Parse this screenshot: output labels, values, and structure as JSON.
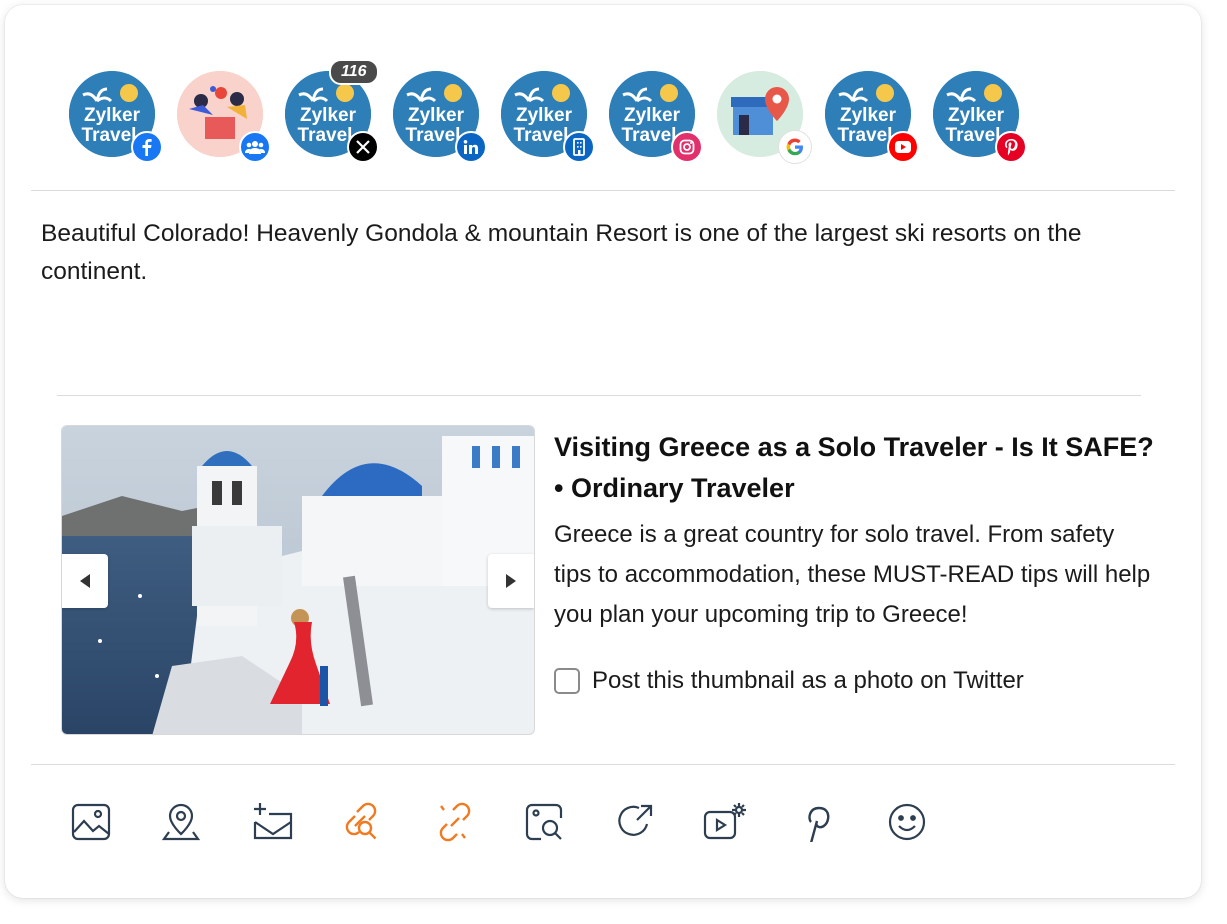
{
  "accounts": [
    {
      "name": "Zylker Travel",
      "network": "facebook",
      "icon": "facebook-icon",
      "badge_color": "#1877f2"
    },
    {
      "name": "Group",
      "network": "facebook-group",
      "icon": "group-icon",
      "badge_color": "#1877f2"
    },
    {
      "name": "Zylker Travel",
      "network": "x",
      "icon": "x-icon",
      "badge_color": "#000000",
      "count": "116"
    },
    {
      "name": "Zylker Travel",
      "network": "linkedin",
      "icon": "linkedin-icon",
      "badge_color": "#0a66c2"
    },
    {
      "name": "Zylker Travel",
      "network": "linkedin-page",
      "icon": "building-icon",
      "badge_color": "#0a66c2"
    },
    {
      "name": "Zylker Travel",
      "network": "instagram",
      "icon": "instagram-icon",
      "badge_color": "#e1306c"
    },
    {
      "name": "Google Business",
      "network": "google",
      "icon": "google-icon",
      "badge_color": "#4285f4"
    },
    {
      "name": "Zylker Travel",
      "network": "youtube",
      "icon": "youtube-icon",
      "badge_color": "#ff0000"
    },
    {
      "name": "Zylker Travel",
      "network": "pinterest",
      "icon": "pinterest-icon",
      "badge_color": "#e60023"
    }
  ],
  "avatar_text": {
    "line1": "Zylker",
    "line2": "Travel"
  },
  "post": {
    "text": "Beautiful Colorado! Heavenly Gondola & mountain Resort is one of the largest ski resorts on the continent."
  },
  "link_preview": {
    "title_line1": "Visiting Greece as a Solo Traveler - Is It SAFE?",
    "title_line2": "• Ordinary Traveler",
    "description": "Greece is a great country for solo travel. From safety tips to accommodation, these MUST-READ tips will help you plan your upcoming trip to Greece!",
    "checkbox_label": "Post this thumbnail as a photo on Twitter",
    "checkbox_checked": false
  },
  "toolbar": [
    {
      "icon": "image-icon",
      "color": "#2c3e50"
    },
    {
      "icon": "location-icon",
      "color": "#2c3e50"
    },
    {
      "icon": "add-mail-icon",
      "color": "#2c3e50"
    },
    {
      "icon": "link-search-icon",
      "color": "#f07a22"
    },
    {
      "icon": "unlink-icon",
      "color": "#f07a22"
    },
    {
      "icon": "image-search-icon",
      "color": "#2c3e50"
    },
    {
      "icon": "share-icon",
      "color": "#2c3e50"
    },
    {
      "icon": "video-settings-icon",
      "color": "#2c3e50"
    },
    {
      "icon": "pinterest-icon",
      "color": "#2c3e50"
    },
    {
      "icon": "emoji-icon",
      "color": "#2c3e50"
    }
  ],
  "colors": {
    "accent": "#f07a22",
    "icon": "#2c3e50",
    "avatar_bg": "#2e7fb7"
  }
}
